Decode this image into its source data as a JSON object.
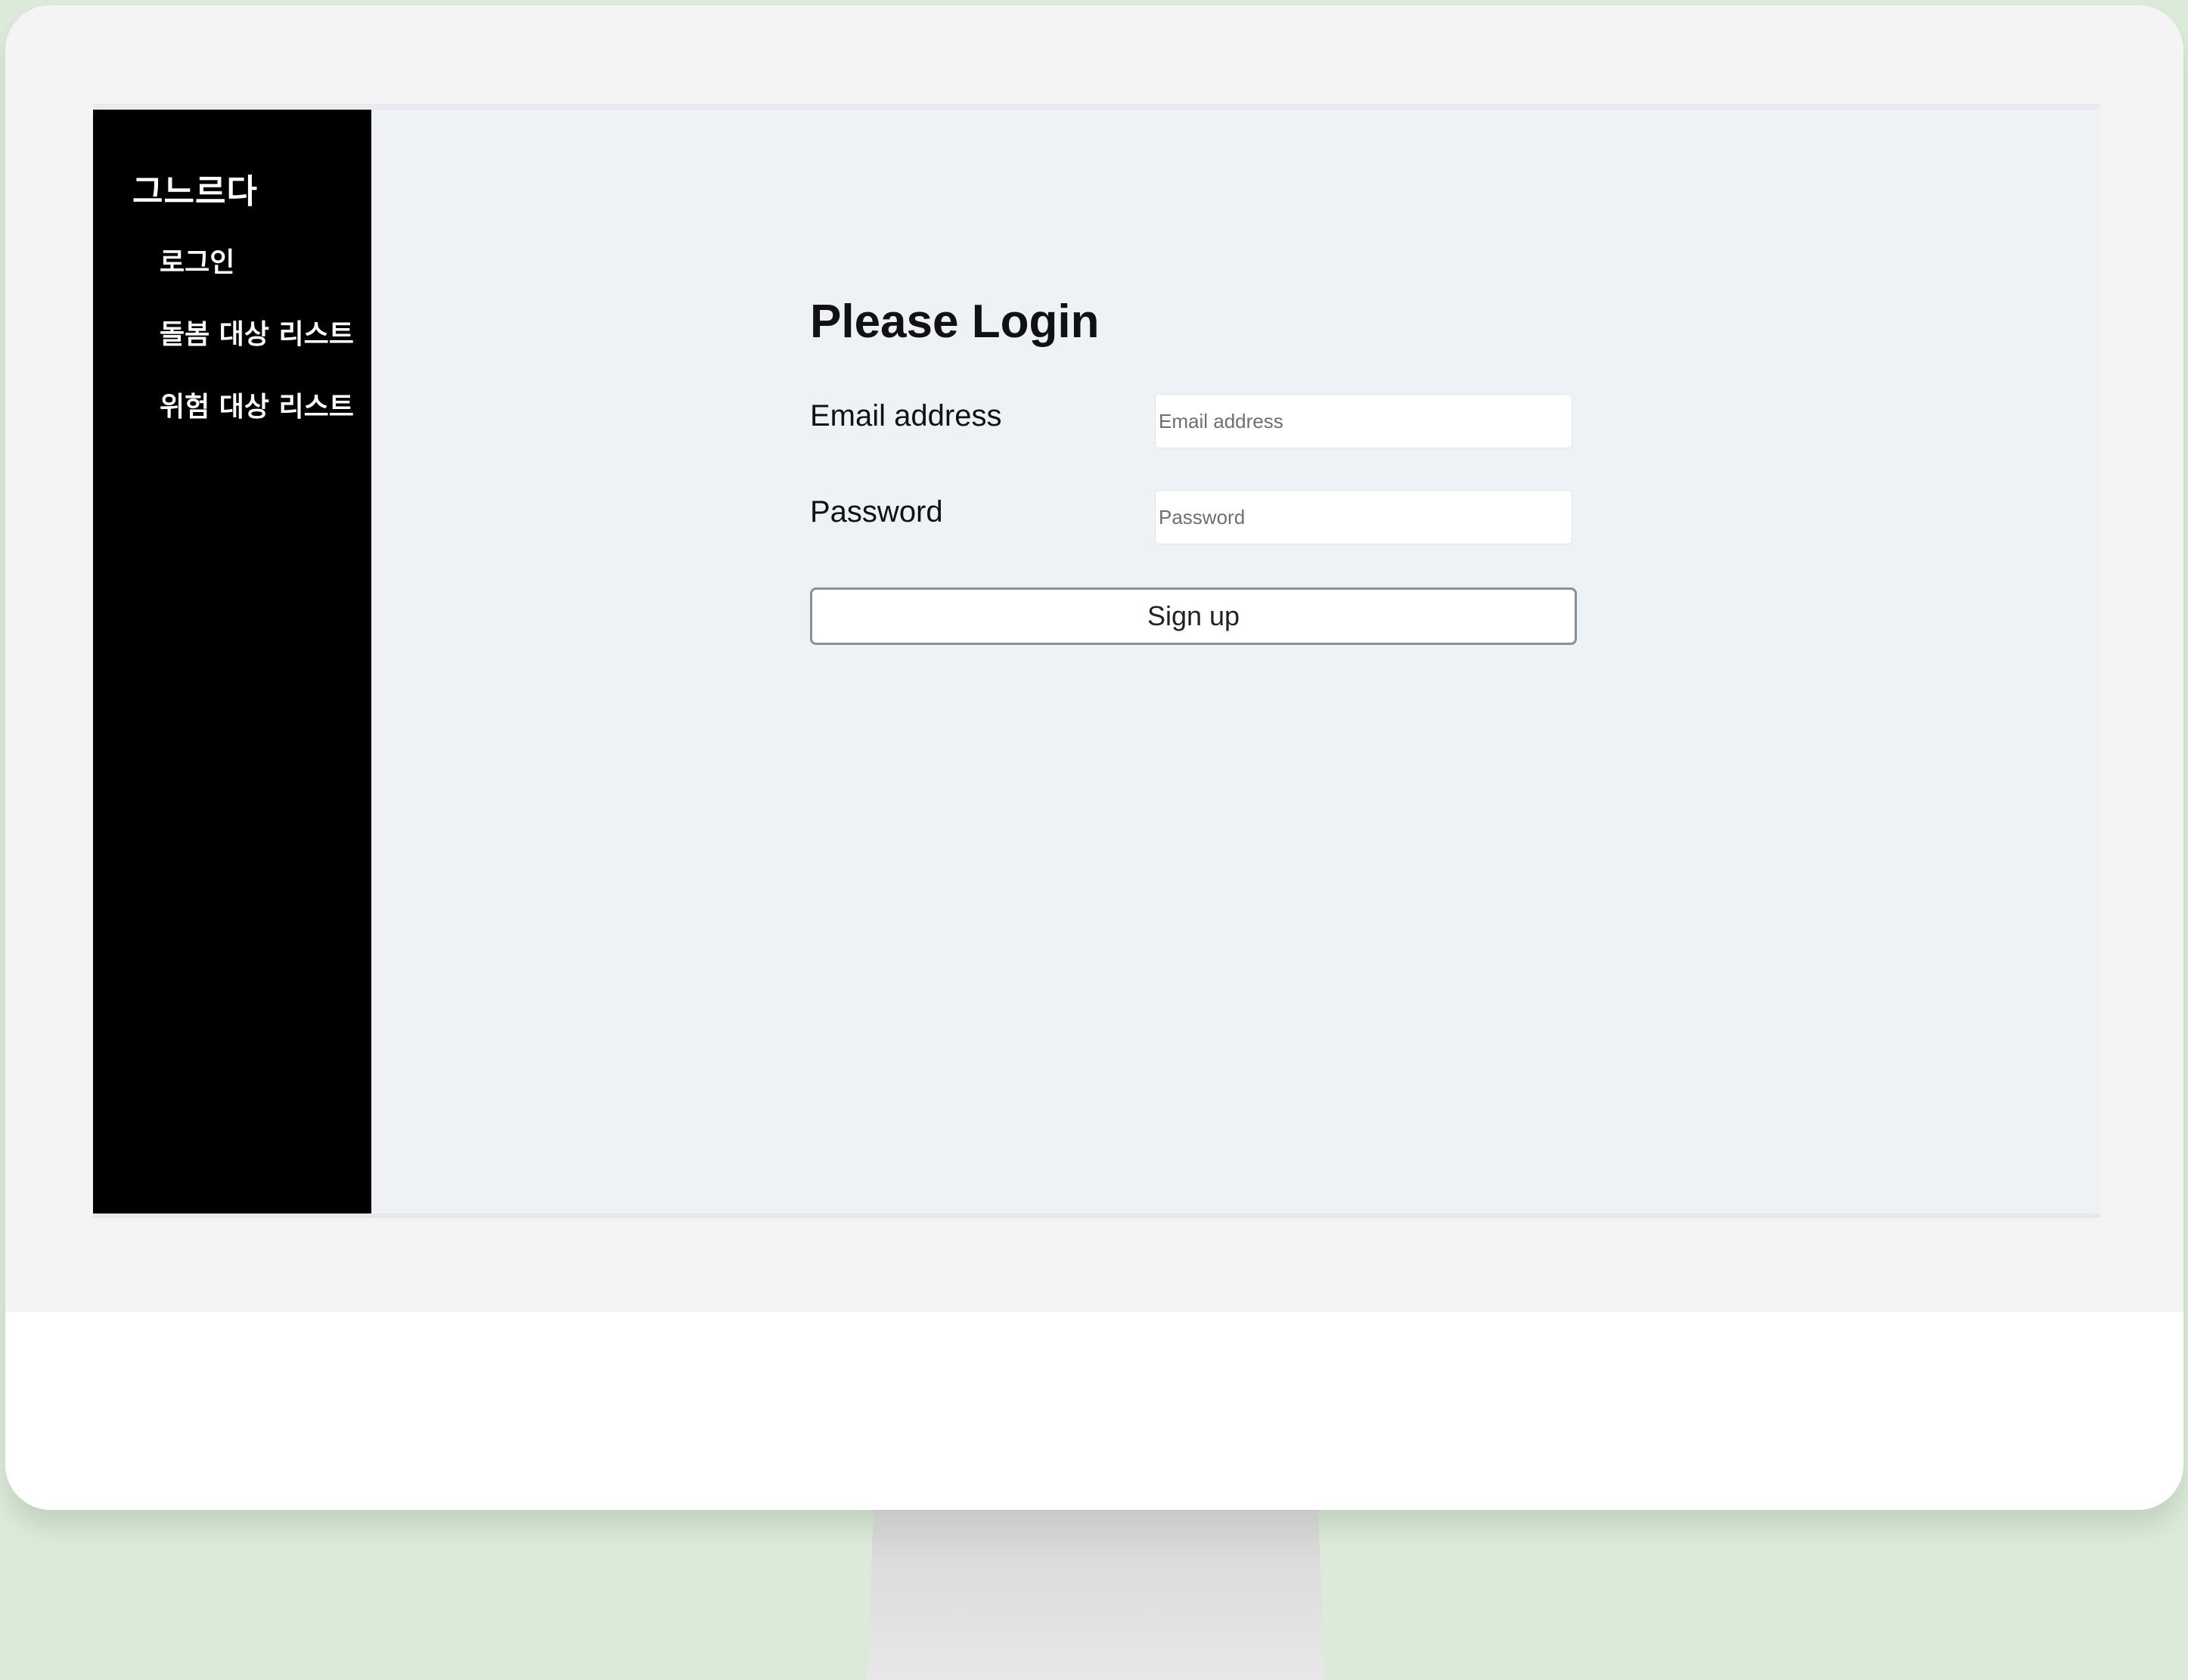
{
  "sidebar": {
    "brand": "그느르다",
    "items": [
      {
        "label": "로그인"
      },
      {
        "label": "돌봄 대상 리스트"
      },
      {
        "label": "위험 대상 리스트"
      }
    ]
  },
  "login": {
    "title": "Please Login",
    "email_label": "Email address",
    "email_placeholder": "Email address",
    "email_value": "",
    "password_label": "Password",
    "password_placeholder": "Password",
    "password_value": "",
    "submit_label": "Sign up"
  },
  "colors": {
    "background": "#dcebd9",
    "sidebar": "#000000",
    "screen": "#eef2f6",
    "text": "#111111"
  }
}
